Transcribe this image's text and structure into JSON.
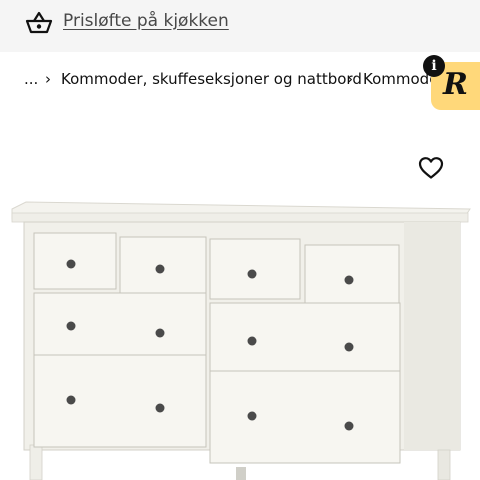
{
  "promo": {
    "icon": "shopping-basket-icon",
    "label": "Prisløfte på kjøkken"
  },
  "breadcrumb": {
    "ellipsis": "...",
    "separator": "›",
    "items": [
      "Kommoder, skuffeseksjoner og nattbord",
      "Kommode"
    ]
  },
  "badge": {
    "info": "i",
    "logo_letter": "R",
    "color": "#ffd87a"
  },
  "favorite": {
    "icon": "heart-outline-icon"
  },
  "product_image": {
    "subject": "white dresser with eight drawers",
    "color": "#f2f1ec"
  }
}
